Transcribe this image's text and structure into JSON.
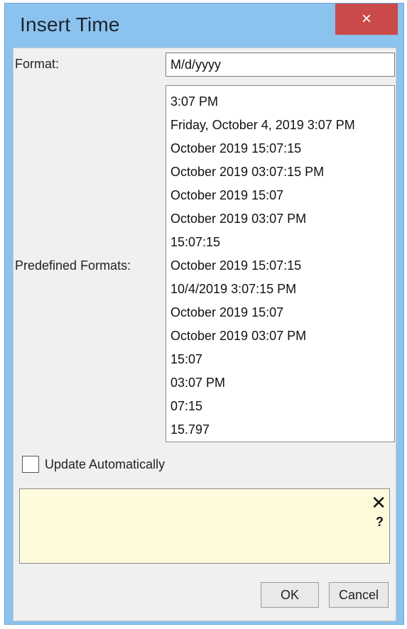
{
  "window": {
    "title": "Insert Time",
    "close_icon": "×"
  },
  "format": {
    "label": "Format:",
    "value": "M/d/yyyy"
  },
  "predefined": {
    "label": "Predefined Formats:",
    "items": [
      "3:07 PM",
      "Friday, October 4, 2019 3:07 PM",
      "October 2019 15:07:15",
      "October 2019 03:07:15 PM",
      "October 2019 15:07",
      "October 2019 03:07 PM",
      "15:07:15",
      "October 2019 15:07:15",
      "10/4/2019 3:07:15 PM",
      "October 2019 15:07",
      "October 2019 03:07 PM",
      "15:07",
      "03:07 PM",
      "07:15",
      "15.797"
    ]
  },
  "update_auto": {
    "label": "Update Automatically",
    "checked": false
  },
  "help": {
    "close_icon": "✕",
    "question_icon": "?"
  },
  "buttons": {
    "ok": "OK",
    "cancel": "Cancel"
  }
}
